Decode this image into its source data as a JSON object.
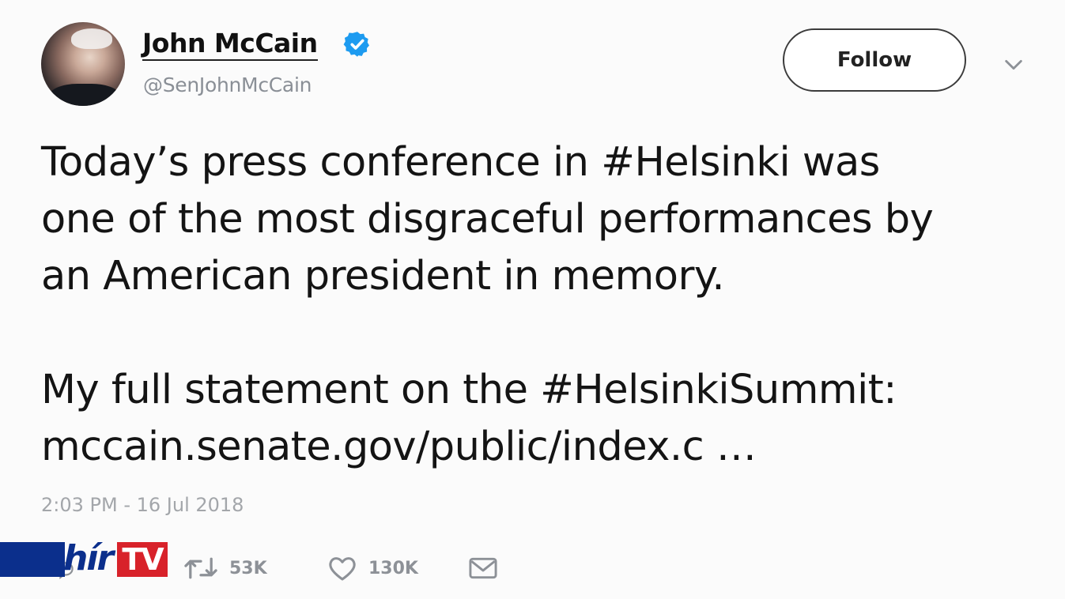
{
  "header": {
    "display_name": "John McCain",
    "handle": "@SenJohnMcCain",
    "follow_label": "Follow"
  },
  "tweet": {
    "lines": [
      "Today’s press conference in #Helsinki was",
      "one of the most disgraceful performances by",
      "an American president in memory.",
      "My full statement on the #HelsinkiSummit:",
      "mccain.senate.gov/public/index.c  …"
    ],
    "timestamp": "2:03 PM - 16 Jul 2018"
  },
  "actions": {
    "retweets": "53K",
    "likes": "130K"
  },
  "watermark": {
    "logo_text_hir": "hír",
    "logo_text_tv": "TV"
  },
  "colors": {
    "verified_badge": "#1d9bf0",
    "logo_blue": "#0b2f8c",
    "logo_red": "#d8222a"
  },
  "icons": {
    "verified": "verified-badge-icon",
    "caret": "chevron-down-icon",
    "reply": "reply-icon",
    "retweet": "retweet-icon",
    "like": "heart-icon",
    "message": "envelope-icon"
  }
}
